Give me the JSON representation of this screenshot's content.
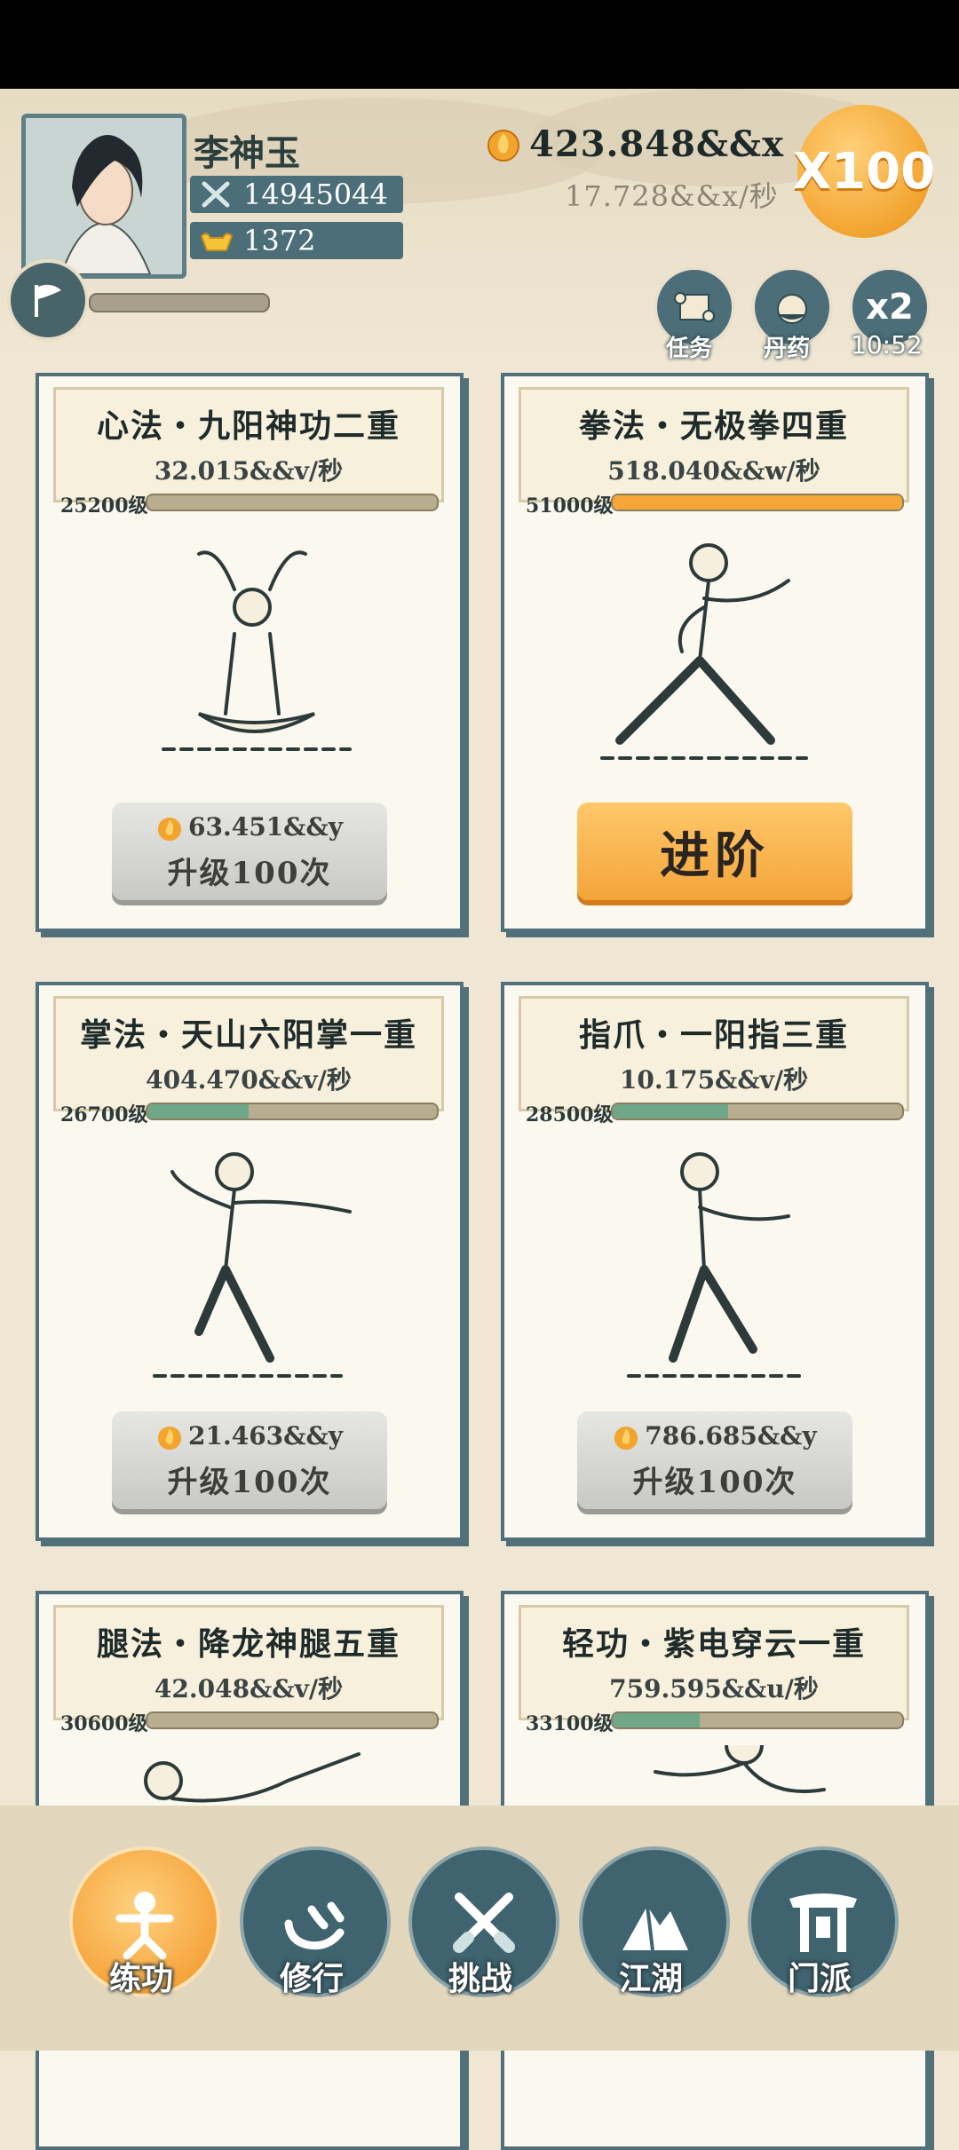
{
  "player": {
    "name": "李神玉",
    "power": "14945044",
    "ingots": "1372"
  },
  "currency": {
    "gold": "423.848&&x",
    "rate": "17.728&&x/秒"
  },
  "multiplier_label": "X100",
  "quick_buttons": {
    "task_label": "任务",
    "pill_label": "丹药",
    "double_label": "x2",
    "timer": "10:52"
  },
  "skills": [
    {
      "title": "心法・九阳神功二重",
      "rate": "32.015&&v/秒",
      "level": "25200级",
      "progress": 0.0,
      "action": "upgrade",
      "cost": "63.451&&y",
      "button_label": "升级100次"
    },
    {
      "title": "拳法・无极拳四重",
      "rate": "518.040&&w/秒",
      "level": "51000级",
      "progress": 1.0,
      "action": "advance",
      "button_label": "进阶"
    },
    {
      "title": "掌法・天山六阳掌一重",
      "rate": "404.470&&v/秒",
      "level": "26700级",
      "progress": 0.35,
      "action": "upgrade",
      "cost": "21.463&&y",
      "button_label": "升级100次"
    },
    {
      "title": "指爪・一阳指三重",
      "rate": "10.175&&v/秒",
      "level": "28500级",
      "progress": 0.4,
      "action": "upgrade",
      "cost": "786.685&&y",
      "button_label": "升级100次"
    },
    {
      "title": "腿法・降龙神腿五重",
      "rate": "42.048&&v/秒",
      "level": "30600级",
      "progress": 0.0,
      "action": "none"
    },
    {
      "title": "轻功・紫电穿云一重",
      "rate": "759.595&&u/秒",
      "level": "33100级",
      "progress": 0.3,
      "action": "none"
    }
  ],
  "nav": [
    {
      "label": "练功",
      "icon": "practice-icon",
      "active": true
    },
    {
      "label": "修行",
      "icon": "heart-icon",
      "active": false
    },
    {
      "label": "挑战",
      "icon": "crossed-swords-icon",
      "active": false
    },
    {
      "label": "江湖",
      "icon": "mountain-icon",
      "active": false
    },
    {
      "label": "门派",
      "icon": "gate-icon",
      "active": false
    }
  ],
  "colors": {
    "card_border": "#52707a",
    "progress_green": "#6fa788",
    "progress_orange": "#f6a636",
    "accent_orange": "#f4a43a"
  }
}
